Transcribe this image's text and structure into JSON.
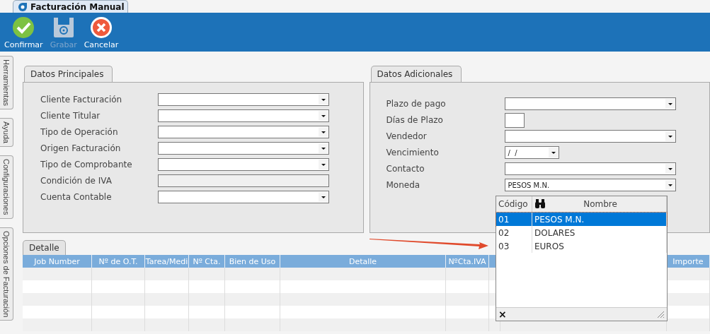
{
  "window_tab": {
    "title": "Facturación Manual",
    "selected": true
  },
  "toolbar": [
    {
      "label": "Confirmar",
      "kind": "confirm",
      "disabled": false
    },
    {
      "label": "Grabar",
      "kind": "save",
      "disabled": true
    },
    {
      "label": "Cancelar",
      "kind": "cancel",
      "disabled": false
    }
  ],
  "side_tabs": [
    "Herramientas",
    "Ayuda",
    "Configuraciones",
    "Opciones de Facturación"
  ],
  "datos_principales": {
    "title": "Datos Principales",
    "fields": [
      {
        "label": "Cliente Facturación",
        "kind": "combo"
      },
      {
        "label": "Cliente Titular",
        "kind": "combo"
      },
      {
        "label": "Tipo de Operación",
        "kind": "combo"
      },
      {
        "label": "Origen Facturación",
        "kind": "combo"
      },
      {
        "label": "Tipo de Comprobante",
        "kind": "combo"
      },
      {
        "label": "Condición de IVA",
        "kind": "readonly"
      },
      {
        "label": "Cuenta Contable",
        "kind": "combo"
      }
    ]
  },
  "datos_adicionales": {
    "title": "Datos Adicionales",
    "fields": [
      {
        "label": "Plazo de pago",
        "kind": "combo"
      },
      {
        "label": "Días de Plazo",
        "kind": "small"
      },
      {
        "label": "Vendedor",
        "kind": "combo"
      },
      {
        "label": "Vencimiento",
        "kind": "date",
        "value": "/  /"
      },
      {
        "label": "Contacto",
        "kind": "combo"
      },
      {
        "label": "Moneda",
        "kind": "combo",
        "value": "PESOS M.N."
      }
    ]
  },
  "detalle": {
    "title": "Detalle",
    "columns": [
      "Job Number",
      "Nº de O.T.",
      "Tarea/Medi",
      "Nº Cta.",
      "Bien de Uso",
      "Detalle",
      "NºCta.IVA",
      "Importe"
    ]
  },
  "currency_dropdown": {
    "columns": [
      "Código",
      "Nombre"
    ],
    "rows": [
      {
        "code": "01",
        "name": "PESOS M.N.",
        "selected": true
      },
      {
        "code": "02",
        "name": "DOLARES",
        "selected": false
      },
      {
        "code": "03",
        "name": "EUROS",
        "selected": false
      }
    ],
    "close": "×"
  }
}
